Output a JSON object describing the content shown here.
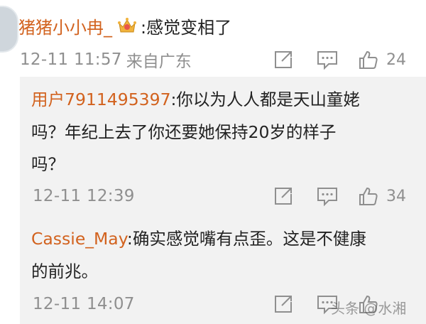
{
  "comment": {
    "username": "猪猪小小冉_",
    "text": ":感觉变相了",
    "time": "12-11 11:57",
    "source": "来自广东",
    "likes": "24",
    "badge_icon": "vip-crown-icon"
  },
  "replies": [
    {
      "username": "用户7911495397",
      "lines": [
        ":你以为人人都是天山童姥",
        "吗？年纪上去了你还要她保持20岁的样子",
        "吗？"
      ],
      "time": "12-11 12:39",
      "likes": "34"
    },
    {
      "username": "Cassie_May",
      "lines": [
        ":确实感觉嘴有点歪。这是不健康",
        "的前兆。"
      ],
      "time": "12-11 14:07",
      "likes": ""
    }
  ],
  "watermark": "头条 @水湘"
}
